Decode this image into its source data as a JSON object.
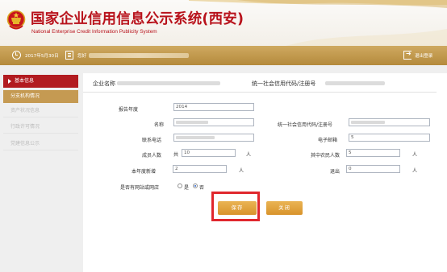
{
  "header": {
    "title": "国家企业信用信息公示系统(西安)",
    "subtitle": "National Enterprise Credit Information Publicity System"
  },
  "toolbar": {
    "date": "2017年5月30日",
    "greeting": "您好",
    "logout": "退出登录"
  },
  "sidebar": {
    "items": [
      {
        "label": "基本信息",
        "state": "active"
      },
      {
        "label": "分支机构情况",
        "state": "selected"
      },
      {
        "label": "资产状况信息",
        "state": "normal"
      },
      {
        "label": "行政许可情况",
        "state": "normal"
      },
      {
        "label": "党建信息公示",
        "state": "normal"
      }
    ]
  },
  "main": {
    "company_name_label": "企业名称",
    "credit_code_label": "统一社会信用代码/注册号"
  },
  "form": {
    "report_year_label": "报告年度",
    "report_year_value": "2014",
    "name_label": "名称",
    "credit_code_label": "统一社会信用代码/注册号",
    "phone_label": "联系电话",
    "email_label": "电子邮箱",
    "email_value": "5",
    "members_label": "成员人数",
    "members_prefix": "共",
    "members_value": "10",
    "members_unit": "人",
    "farmers_label": "其中农民人数",
    "farmers_value": "5",
    "farmers_unit": "人",
    "new_label": "本年度新增",
    "new_value": "2",
    "new_unit": "人",
    "quit_label": "退出",
    "quit_value": "0",
    "quit_unit": "人",
    "website_label": "是否有网站或网店",
    "yes_label": "是",
    "no_label": "否",
    "website_selected": "否"
  },
  "buttons": {
    "save": "保存",
    "close": "关闭"
  },
  "colors": {
    "brand_red": "#b8121b",
    "toolbar_gold": "#c29a4e",
    "button_orange": "#e0a23d",
    "highlight_red": "#e0272d"
  }
}
